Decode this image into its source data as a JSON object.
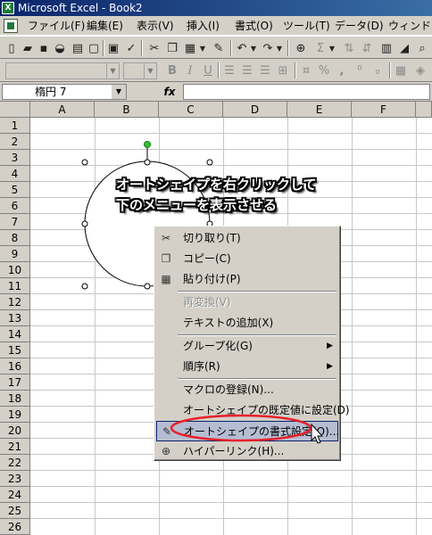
{
  "window": {
    "title": "Microsoft Excel - Book2"
  },
  "menubar": {
    "items": [
      "ファイル(F)",
      "編集(E)",
      "表示(V)",
      "挿入(I)",
      "書式(O)",
      "ツール(T)",
      "データ(D)",
      "ウィンドウ(W)"
    ]
  },
  "toolbar": {
    "icons": [
      "new-icon",
      "open-icon",
      "save-icon",
      "permission-icon",
      "print-icon",
      "print-preview-icon",
      "spelling-icon",
      "cut-icon",
      "copy-icon",
      "paste-icon",
      "format-painter-icon",
      "undo-icon",
      "redo-icon",
      "hyperlink-icon",
      "autosum-icon",
      "sort-icon"
    ]
  },
  "toolbar2": {
    "icons": [
      "bold-icon",
      "italic-icon",
      "underline-icon",
      "align-left-icon",
      "align-center-icon",
      "align-right-icon",
      "merge-icon",
      "currency-icon",
      "percent-icon",
      "comma-icon"
    ],
    "bold": "B",
    "italic": "I",
    "underline": "U",
    "percent": "%",
    "comma": ","
  },
  "formula_bar": {
    "name_box": "楕円 7",
    "fx": "fx",
    "content": ""
  },
  "columns": [
    "A",
    "B",
    "C",
    "D",
    "E",
    "F"
  ],
  "rows": [
    "1",
    "2",
    "3",
    "4",
    "5",
    "6",
    "7",
    "8",
    "9",
    "10",
    "11",
    "12",
    "13",
    "14",
    "15",
    "16",
    "17",
    "18",
    "19",
    "20",
    "21",
    "22",
    "23",
    "24",
    "25",
    "26"
  ],
  "callout": {
    "line1": "オートシェイプを右クリックして",
    "line2": "下のメニューを表示させる"
  },
  "context_menu": {
    "items": [
      {
        "label": "切り取り(T)",
        "icon": "scissors-icon",
        "enabled": true
      },
      {
        "label": "コピー(C)",
        "icon": "copy-icon",
        "enabled": true
      },
      {
        "label": "貼り付け(P)",
        "icon": "paste-icon",
        "enabled": true
      },
      {
        "label": "再変換(V)",
        "enabled": false
      },
      {
        "label": "テキストの追加(X)",
        "enabled": true
      },
      {
        "label": "グループ化(G)",
        "submenu": true,
        "enabled": true
      },
      {
        "label": "順序(R)",
        "submenu": true,
        "enabled": true
      },
      {
        "label": "マクロの登録(N)...",
        "enabled": true
      },
      {
        "label": "オートシェイプの既定値に設定(D)",
        "enabled": true
      },
      {
        "label": "オートシェイプの書式設定(O)...",
        "icon": "format-shape-icon",
        "enabled": true,
        "highlighted": true
      },
      {
        "label": "ハイパーリンク(H)...",
        "icon": "hyperlink-icon",
        "enabled": true
      }
    ]
  },
  "colors": {
    "highlight_ring": "#e8202a",
    "menu_highlight": "#b6bdd2",
    "handle_rotate": "#2ec42e"
  }
}
